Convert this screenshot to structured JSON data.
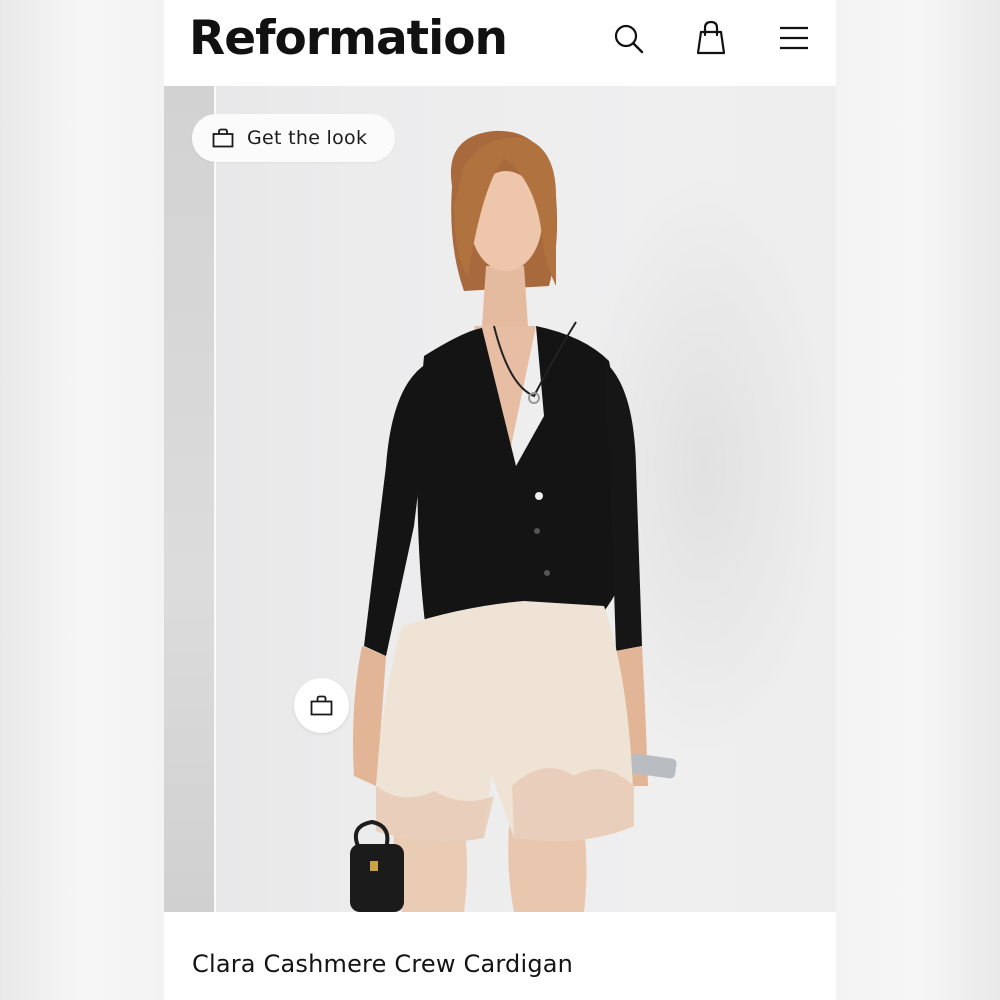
{
  "header": {
    "logo_text": "Reformation",
    "icons": [
      "search-icon",
      "shopping-bag-icon",
      "hamburger-menu-icon"
    ]
  },
  "hero": {
    "get_the_look_label": "Get the look",
    "get_the_look_icon": "shopping-bag-icon",
    "hotspot_icon": "shopping-bag-icon"
  },
  "product": {
    "name": "Clara Cashmere Crew Cardigan"
  },
  "colors": {
    "text": "#111111",
    "cardigan": "#141414",
    "shorts": "#efe3d6",
    "pill_background": "#fbfbfb"
  }
}
